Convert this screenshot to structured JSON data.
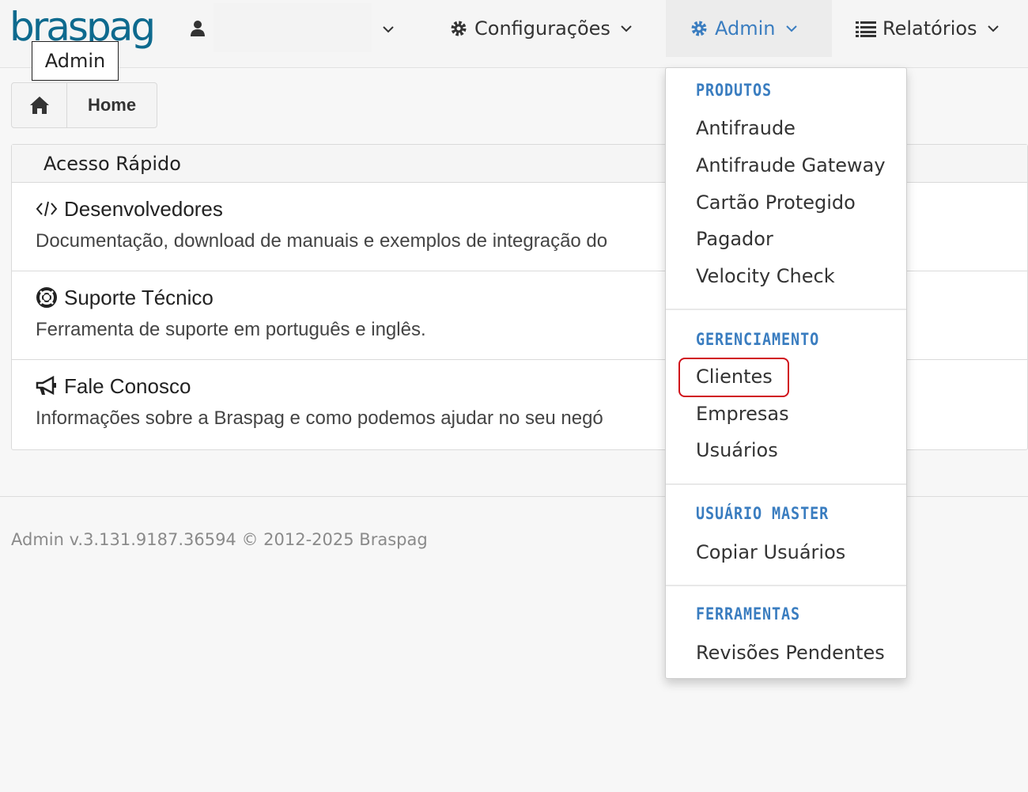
{
  "brand": {
    "logo_text": "braspag",
    "color": "#0e6a8e"
  },
  "navbar": {
    "tooltip": "Admin",
    "config_label": "Configurações",
    "admin_label": "Admin",
    "reports_label": "Relatórios",
    "accent_color": "#3a7dc0"
  },
  "breadcrumb": {
    "home_label": "Home"
  },
  "panel": {
    "title": "Acesso Rápido",
    "rows": [
      {
        "icon": "code-icon",
        "title": "Desenvolvedores",
        "desc": "Documentação, download de manuais e exemplos de integração do"
      },
      {
        "icon": "lifebuoy-icon",
        "title": "Suporte Técnico",
        "desc": "Ferramenta de suporte em português e inglês."
      },
      {
        "icon": "bullhorn-icon",
        "title": "Fale Conosco",
        "desc": "Informações sobre a Braspag e como podemos ajudar no seu negó"
      }
    ]
  },
  "footer": {
    "text": "Admin v.3.131.9187.36594 © 2012-2025 Braspag"
  },
  "dropdown": {
    "sections": [
      {
        "header": "PRODUTOS",
        "items": [
          "Antifraude",
          "Antifraude Gateway",
          "Cartão Protegido",
          "Pagador",
          "Velocity Check"
        ]
      },
      {
        "header": "GERENCIAMENTO",
        "items": [
          "Clientes",
          "Empresas",
          "Usuários"
        ]
      },
      {
        "header": "USUÁRIO MASTER",
        "items": [
          "Copiar Usuários"
        ]
      },
      {
        "header": "FERRAMENTAS",
        "items": [
          "Revisões Pendentes"
        ]
      }
    ],
    "highlighted_item": "Clientes",
    "highlight_color": "#d0101a"
  }
}
